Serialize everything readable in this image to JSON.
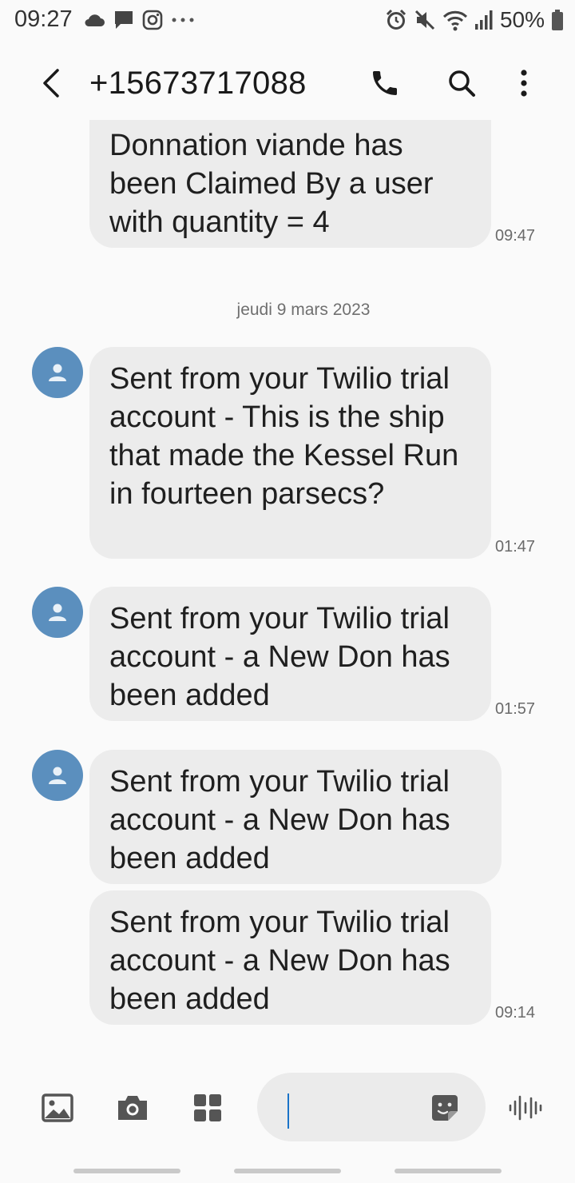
{
  "status_bar": {
    "time": "09:27",
    "battery": "50%"
  },
  "header": {
    "contact": "+15673717088"
  },
  "messages": {
    "m0": {
      "text": "Donnation viande has been Claimed By a user with  quantity = 4",
      "time": "09:47"
    },
    "date": "jeudi 9 mars 2023",
    "m1": {
      "text": "Sent from your Twilio trial account - This is the ship that made the Kessel Run in fourteen parsecs?",
      "time": "01:47"
    },
    "m2": {
      "text": "Sent from your Twilio trial account - a New Don has been added",
      "time": "01:57"
    },
    "m3": {
      "text": "Sent from your Twilio trial account - a New Don has been added"
    },
    "m4": {
      "text": "Sent from your Twilio trial account - a New Don has been added",
      "time": "09:14"
    }
  },
  "composer": {
    "value": ""
  },
  "icons": {
    "status": [
      "cloud-icon",
      "chat-bubble-icon",
      "instagram-icon",
      "more-dots-icon",
      "alarm-icon",
      "mute-icon",
      "wifi-icon",
      "signal-icon",
      "battery-icon"
    ],
    "header": [
      "back-arrow-icon",
      "phone-icon",
      "search-icon",
      "more-vertical-icon"
    ],
    "composer": [
      "gallery-icon",
      "camera-icon",
      "apps-grid-icon",
      "sticker-icon",
      "voice-wave-icon"
    ]
  },
  "colors": {
    "avatar": "#5b8fbe",
    "bubble": "#ececec",
    "caret": "#1a73c8",
    "background": "#fafafa"
  }
}
